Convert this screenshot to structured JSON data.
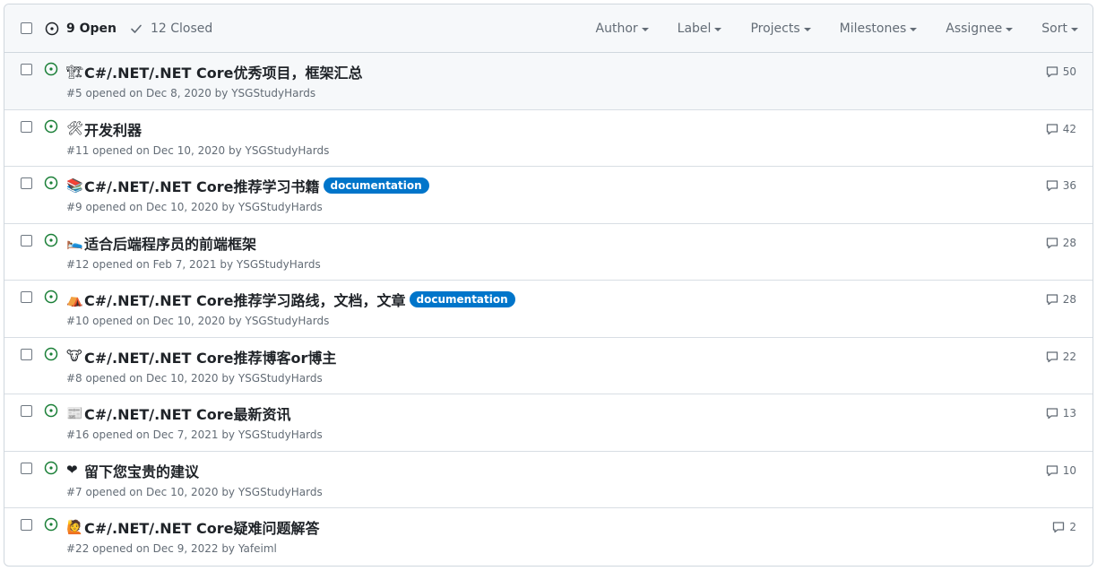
{
  "header": {
    "open_label": "9 Open",
    "closed_label": "12 Closed",
    "filters": [
      "Author",
      "Label",
      "Projects",
      "Milestones",
      "Assignee",
      "Sort"
    ]
  },
  "colors": {
    "open": "#1a7f37",
    "label_documentation": "#0075ca"
  },
  "issues": [
    {
      "emoji": "🏗",
      "title": "C#/.NET/.NET Core优秀项目，框架汇总",
      "meta": "#5 opened on Dec 8, 2020 by YSGStudyHards",
      "label": "",
      "comments": "50"
    },
    {
      "emoji": "🛠",
      "title": "开发利器",
      "meta": "#11 opened on Dec 10, 2020 by YSGStudyHards",
      "label": "",
      "comments": "42"
    },
    {
      "emoji": "📚",
      "title": "C#/.NET/.NET Core推荐学习书籍",
      "meta": "#9 opened on Dec 10, 2020 by YSGStudyHards",
      "label": "documentation",
      "comments": "36"
    },
    {
      "emoji": "🛌",
      "title": "适合后端程序员的前端框架",
      "meta": "#12 opened on Feb 7, 2021 by YSGStudyHards",
      "label": "",
      "comments": "28"
    },
    {
      "emoji": "⛺",
      "title": "C#/.NET/.NET Core推荐学习路线，文档，文章",
      "meta": "#10 opened on Dec 10, 2020 by YSGStudyHards",
      "label": "documentation",
      "comments": "28"
    },
    {
      "emoji": "🐮",
      "title": "C#/.NET/.NET Core推荐博客or博主",
      "meta": "#8 opened on Dec 10, 2020 by YSGStudyHards",
      "label": "",
      "comments": "22"
    },
    {
      "emoji": "📰",
      "title": "C#/.NET/.NET Core最新资讯",
      "meta": "#16 opened on Dec 7, 2021 by YSGStudyHards",
      "label": "",
      "comments": "13"
    },
    {
      "emoji": "❤",
      "title": "留下您宝贵的建议",
      "meta": "#7 opened on Dec 10, 2020 by YSGStudyHards",
      "label": "",
      "comments": "10"
    },
    {
      "emoji": "🙋",
      "title": "C#/.NET/.NET Core疑难问题解答",
      "meta": "#22 opened on Dec 9, 2022 by Yafeiml",
      "label": "",
      "comments": "2"
    }
  ]
}
